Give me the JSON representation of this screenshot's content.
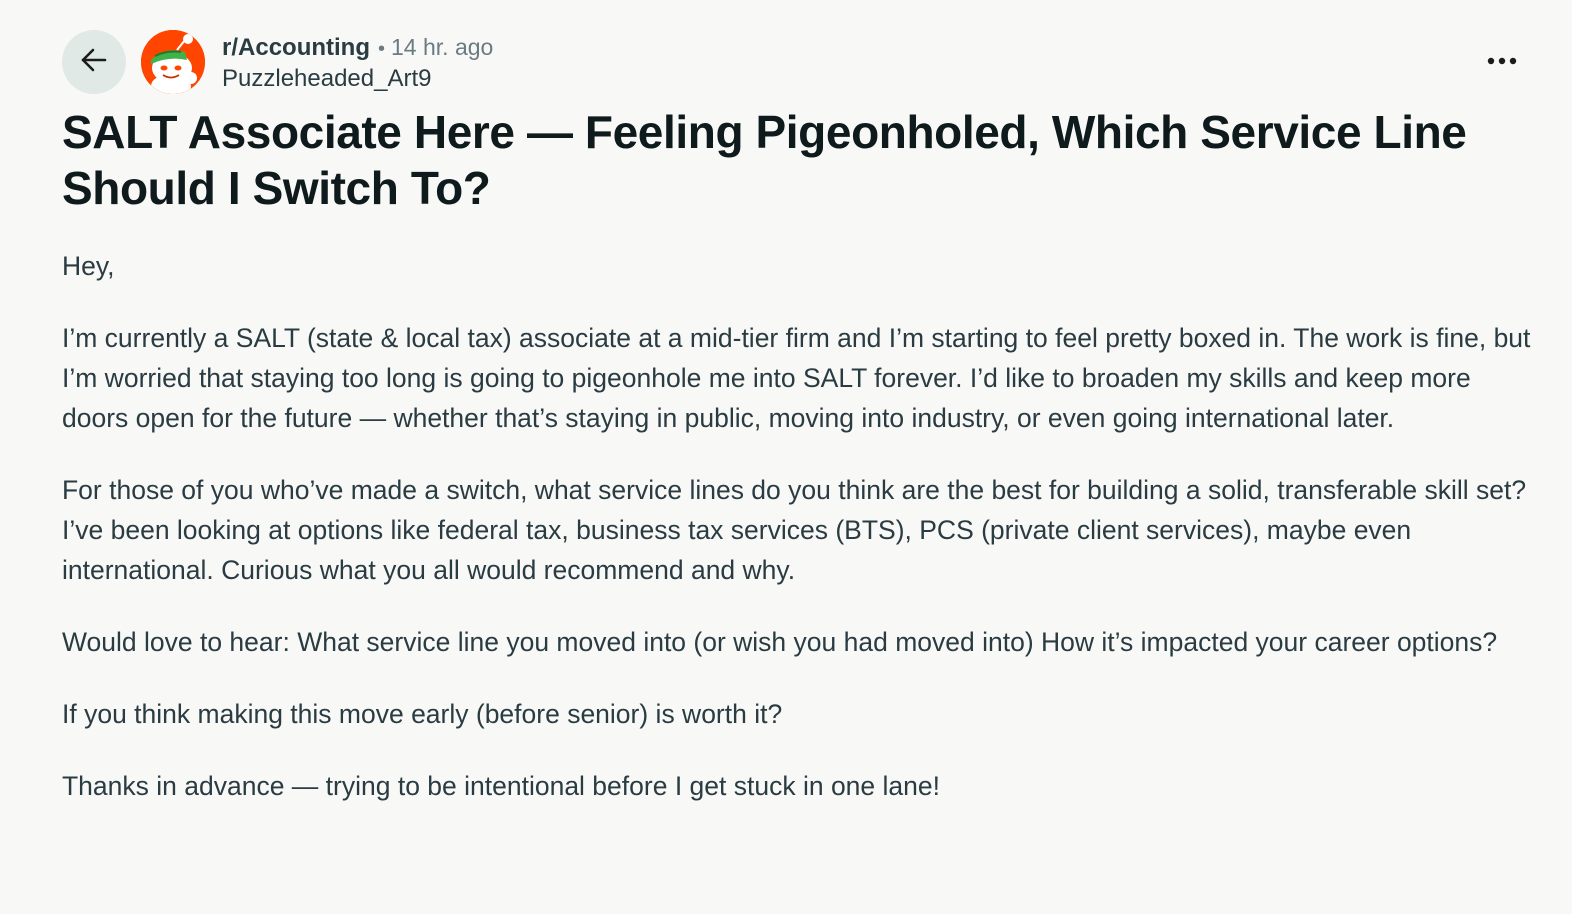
{
  "header": {
    "subreddit": "r/Accounting",
    "separator": "•",
    "time_ago": "14 hr. ago",
    "author": "Puzzleheaded_Art9"
  },
  "icons": {
    "back": "arrow-left-icon",
    "avatar": "subreddit-avatar-icon",
    "more": "more-horizontal-icon"
  },
  "colors": {
    "avatar_bg": "#ff4500",
    "back_btn_bg": "#e1e9e6",
    "background": "#f8f8f7"
  },
  "post": {
    "title": "SALT Associate Here — Feeling Pigeonholed, Which Service Line Should I Switch To?",
    "paragraphs": [
      "Hey,",
      "I’m currently a SALT (state & local tax) associate at a mid-tier firm and I’m starting to feel pretty boxed in. The work is fine, but I’m worried that staying too long is going to pigeonhole me into SALT forever. I’d like to broaden my skills and keep more doors open for the future — whether that’s staying in public, moving into industry, or even going international later.",
      "For those of you who’ve made a switch, what service lines do you think are the best for building a solid, transferable skill set? I’ve been looking at options like federal tax, business tax services (BTS), PCS (private client services), maybe even international. Curious what you all would recommend and why.",
      "Would love to hear: What service line you moved into (or wish you had moved into) How it’s impacted your career options?",
      "If you think making this move early (before senior) is worth it?",
      "Thanks in advance — trying to be intentional before I get stuck in one lane!"
    ]
  }
}
